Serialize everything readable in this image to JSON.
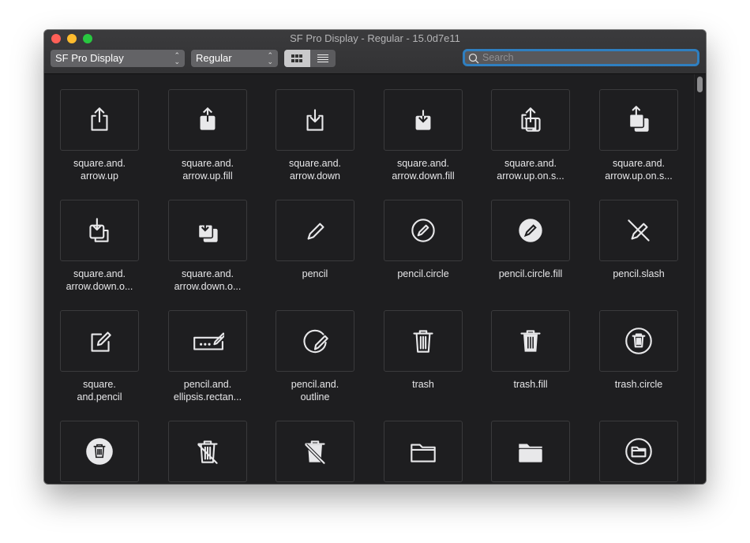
{
  "window": {
    "title": "SF Pro Display - Regular - 15.0d7e11"
  },
  "toolbar": {
    "font_family": "SF Pro Display",
    "font_style": "Regular",
    "view_grid": "grid-icon",
    "view_list": "list-icon",
    "search_placeholder": "Search"
  },
  "colors": {
    "close": "#ff5f57",
    "minimize": "#febc2e",
    "zoom": "#28c840",
    "focus_ring": "#2f7fc0"
  },
  "symbols": [
    {
      "label": [
        "square.and.",
        "arrow.up"
      ],
      "icon": "square-arrow-up"
    },
    {
      "label": [
        "square.and.",
        "arrow.up.fill"
      ],
      "icon": "square-arrow-up-fill"
    },
    {
      "label": [
        "square.and.",
        "arrow.down"
      ],
      "icon": "square-arrow-down"
    },
    {
      "label": [
        "square.and.",
        "arrow.down.fill"
      ],
      "icon": "square-arrow-down-fill"
    },
    {
      "label": [
        "square.and.",
        "arrow.up.on.s..."
      ],
      "icon": "square-arrow-up-on-square"
    },
    {
      "label": [
        "square.and.",
        "arrow.up.on.s..."
      ],
      "icon": "square-arrow-up-on-square-fill"
    },
    {
      "label": [
        "square.and.",
        "arrow.down.o..."
      ],
      "icon": "square-arrow-down-on-square"
    },
    {
      "label": [
        "square.and.",
        "arrow.down.o..."
      ],
      "icon": "square-arrow-down-on-square-fill"
    },
    {
      "label": [
        "pencil",
        ""
      ],
      "icon": "pencil"
    },
    {
      "label": [
        "pencil.circle",
        ""
      ],
      "icon": "pencil-circle"
    },
    {
      "label": [
        "pencil.circle.fill",
        ""
      ],
      "icon": "pencil-circle-fill"
    },
    {
      "label": [
        "pencil.slash",
        ""
      ],
      "icon": "pencil-slash"
    },
    {
      "label": [
        "square.",
        "and.pencil"
      ],
      "icon": "square-and-pencil"
    },
    {
      "label": [
        "pencil.and.",
        "ellipsis.rectan..."
      ],
      "icon": "pencil-ellipsis-rectangle"
    },
    {
      "label": [
        "pencil.and.",
        "outline"
      ],
      "icon": "pencil-outline"
    },
    {
      "label": [
        "trash",
        ""
      ],
      "icon": "trash"
    },
    {
      "label": [
        "trash.fill",
        ""
      ],
      "icon": "trash-fill"
    },
    {
      "label": [
        "trash.circle",
        ""
      ],
      "icon": "trash-circle"
    },
    {
      "label": [
        "",
        ""
      ],
      "icon": "trash-circle-fill"
    },
    {
      "label": [
        "",
        ""
      ],
      "icon": "trash-slash"
    },
    {
      "label": [
        "",
        ""
      ],
      "icon": "trash-slash-fill"
    },
    {
      "label": [
        "",
        ""
      ],
      "icon": "folder"
    },
    {
      "label": [
        "",
        ""
      ],
      "icon": "folder-fill"
    },
    {
      "label": [
        "",
        ""
      ],
      "icon": "folder-circle"
    }
  ]
}
